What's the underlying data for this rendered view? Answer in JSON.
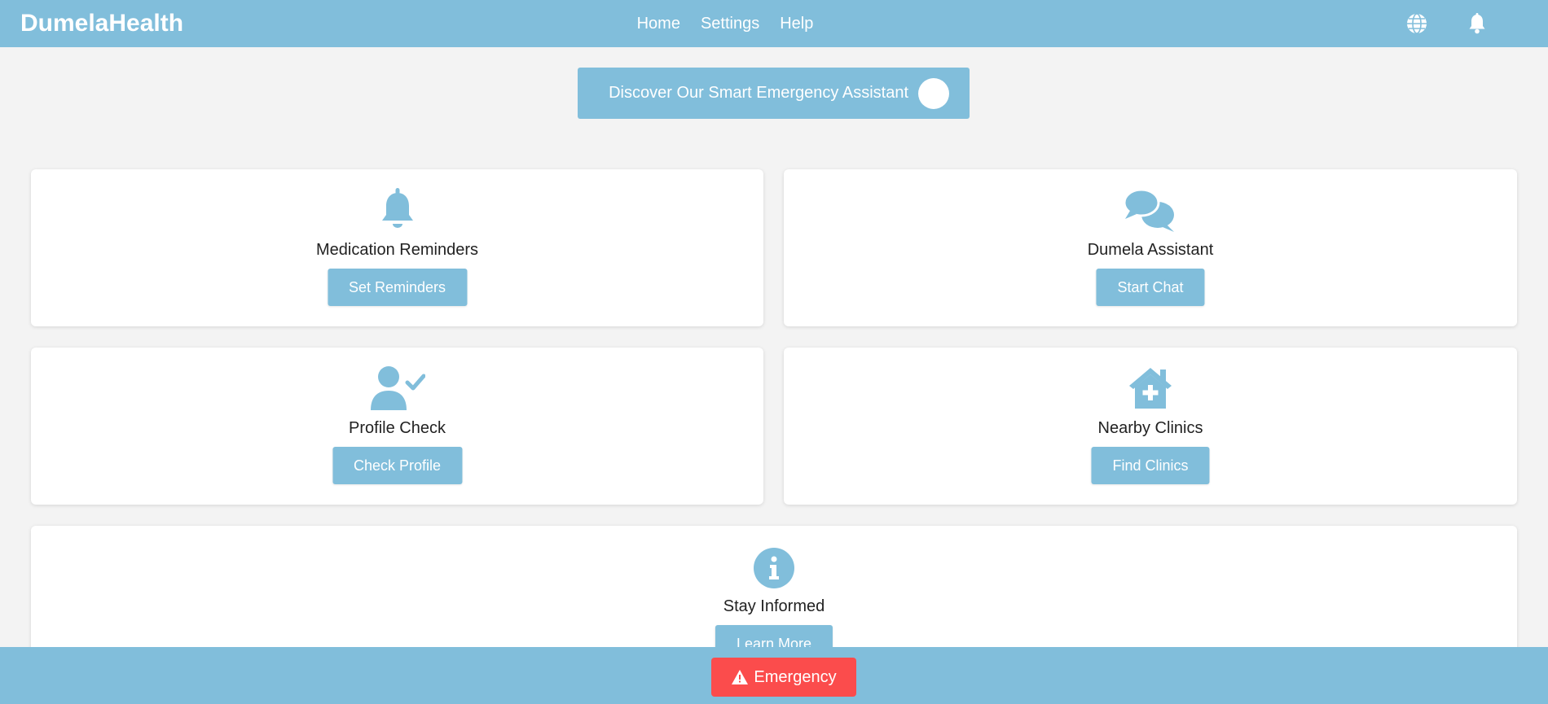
{
  "header": {
    "brand": "DumelaHealth",
    "nav": [
      "Home",
      "Settings",
      "Help"
    ],
    "icons": [
      "globe-icon",
      "bell-icon"
    ]
  },
  "promo": {
    "label": "Discover Our Smart Emergency Assistant"
  },
  "cards": [
    {
      "title": "Medication Reminders",
      "button": "Set Reminders",
      "icon": "bell-icon"
    },
    {
      "title": "Dumela Assistant",
      "button": "Start Chat",
      "icon": "chat-bubbles-icon"
    },
    {
      "title": "Profile Check",
      "button": "Check Profile",
      "icon": "user-check-icon"
    },
    {
      "title": "Nearby Clinics",
      "button": "Find Clinics",
      "icon": "clinic-house-icon"
    },
    {
      "title": "Stay Informed",
      "button": "Learn More",
      "icon": "info-circle-icon"
    }
  ],
  "footer": {
    "emergency_label": "Emergency",
    "emergency_icon": "warning-triangle-icon"
  },
  "colors": {
    "primary": "#81bedb",
    "background": "#f3f3f3",
    "emergency": "#fb4c4c"
  }
}
